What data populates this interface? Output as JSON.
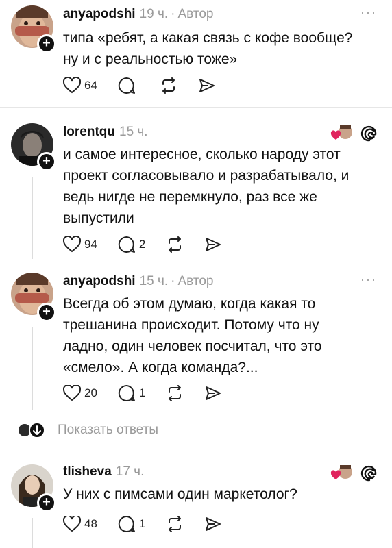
{
  "posts": [
    {
      "username": "anyapodshi",
      "time": "19 ч.",
      "author_label": "Автор",
      "text_lines": [
        "типа «ребят, а какая связь с кофе вообще?",
        "ну и с реальностью тоже»"
      ],
      "likes": "64",
      "replies": ""
    },
    {
      "username": "lorentqu",
      "time": "15 ч.",
      "text_lines": [
        "и самое интересное, сколько народу этот",
        "проект согласовывало и разрабатывало, и",
        "ведь нигде не перемкнуло, раз все же",
        "выпустили"
      ],
      "likes": "94",
      "replies": "2"
    },
    {
      "username": "anyapodshi",
      "time": "15 ч.",
      "author_label": "Автор",
      "text_lines": [
        "Всегда об этом думаю, когда какая то",
        "трешанина происходит. Потому что ну",
        "ладно, один человек посчитал, что это",
        "«смело». А когда команда?..."
      ],
      "likes": "20",
      "replies": "1"
    },
    {
      "username": "tlisheva",
      "time": "17 ч.",
      "text_lines": [
        "У них с пимсами один маркетолог?"
      ],
      "likes": "48",
      "replies": "1"
    }
  ],
  "show_replies_label": "Показать ответы",
  "more_label": "···",
  "colors": {
    "text": "#111111",
    "muted": "#9a9a9a",
    "like_red": "#e0245e",
    "divider": "#e6e6e6"
  },
  "icons": [
    "heart-icon",
    "comment-icon",
    "repost-icon",
    "share-icon",
    "threads-logo-icon",
    "more-icon",
    "follow-plus-icon"
  ]
}
